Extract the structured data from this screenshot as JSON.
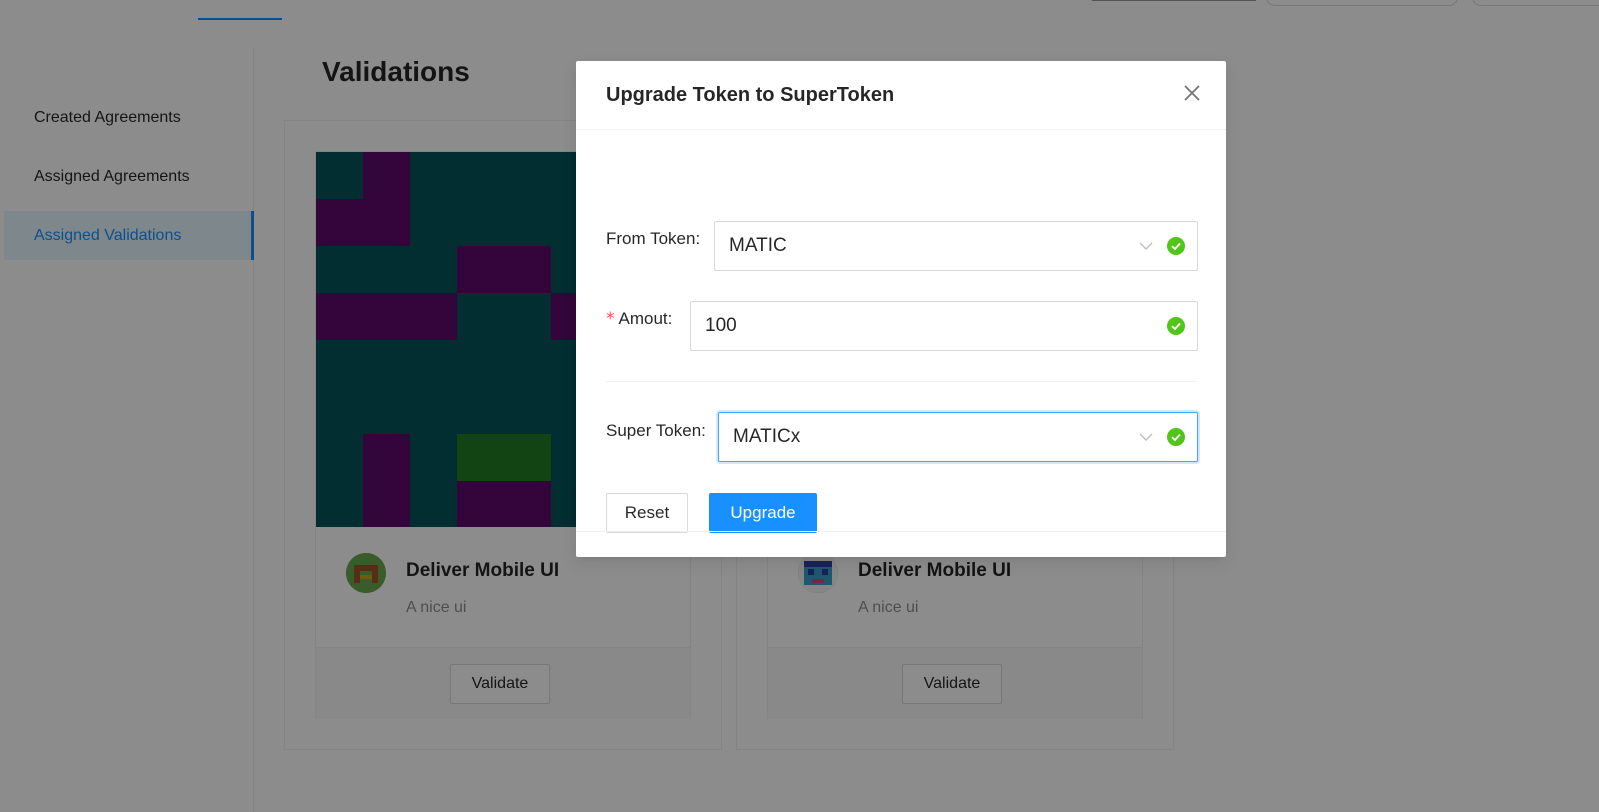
{
  "sidebar": {
    "items": [
      {
        "label": "Created Agreements"
      },
      {
        "label": "Assigned Agreements"
      },
      {
        "label": "Assigned Validations",
        "selected": true
      }
    ]
  },
  "content": {
    "title": "Validations",
    "cards": [
      {
        "title": "Deliver Mobile UI",
        "description": "A nice ui",
        "action_label": "Validate"
      },
      {
        "title": "Deliver Mobile UI",
        "description": "A nice ui",
        "action_label": "Validate"
      }
    ]
  },
  "modal": {
    "title": "Upgrade Token to SuperToken",
    "form": {
      "from_token": {
        "label": "From Token",
        "value": "MATIC",
        "status": "success"
      },
      "amount": {
        "label": "Amout",
        "value": "100",
        "required": true,
        "status": "success"
      },
      "super_token": {
        "label": "Super Token",
        "value": "MATICx",
        "status": "success"
      }
    },
    "reset_label": "Reset",
    "upgrade_label": "Upgrade"
  },
  "colors": {
    "primary": "#1890ff",
    "success": "#52c41a",
    "required": "#ff4d4f",
    "cover_teal": "#045359",
    "cover_purple": "#5f0a6b",
    "cover_green": "#217a23"
  },
  "icons": {
    "close": "close-icon",
    "select_arrow": "chevron-down-icon",
    "validation": "check-circle-icon"
  }
}
